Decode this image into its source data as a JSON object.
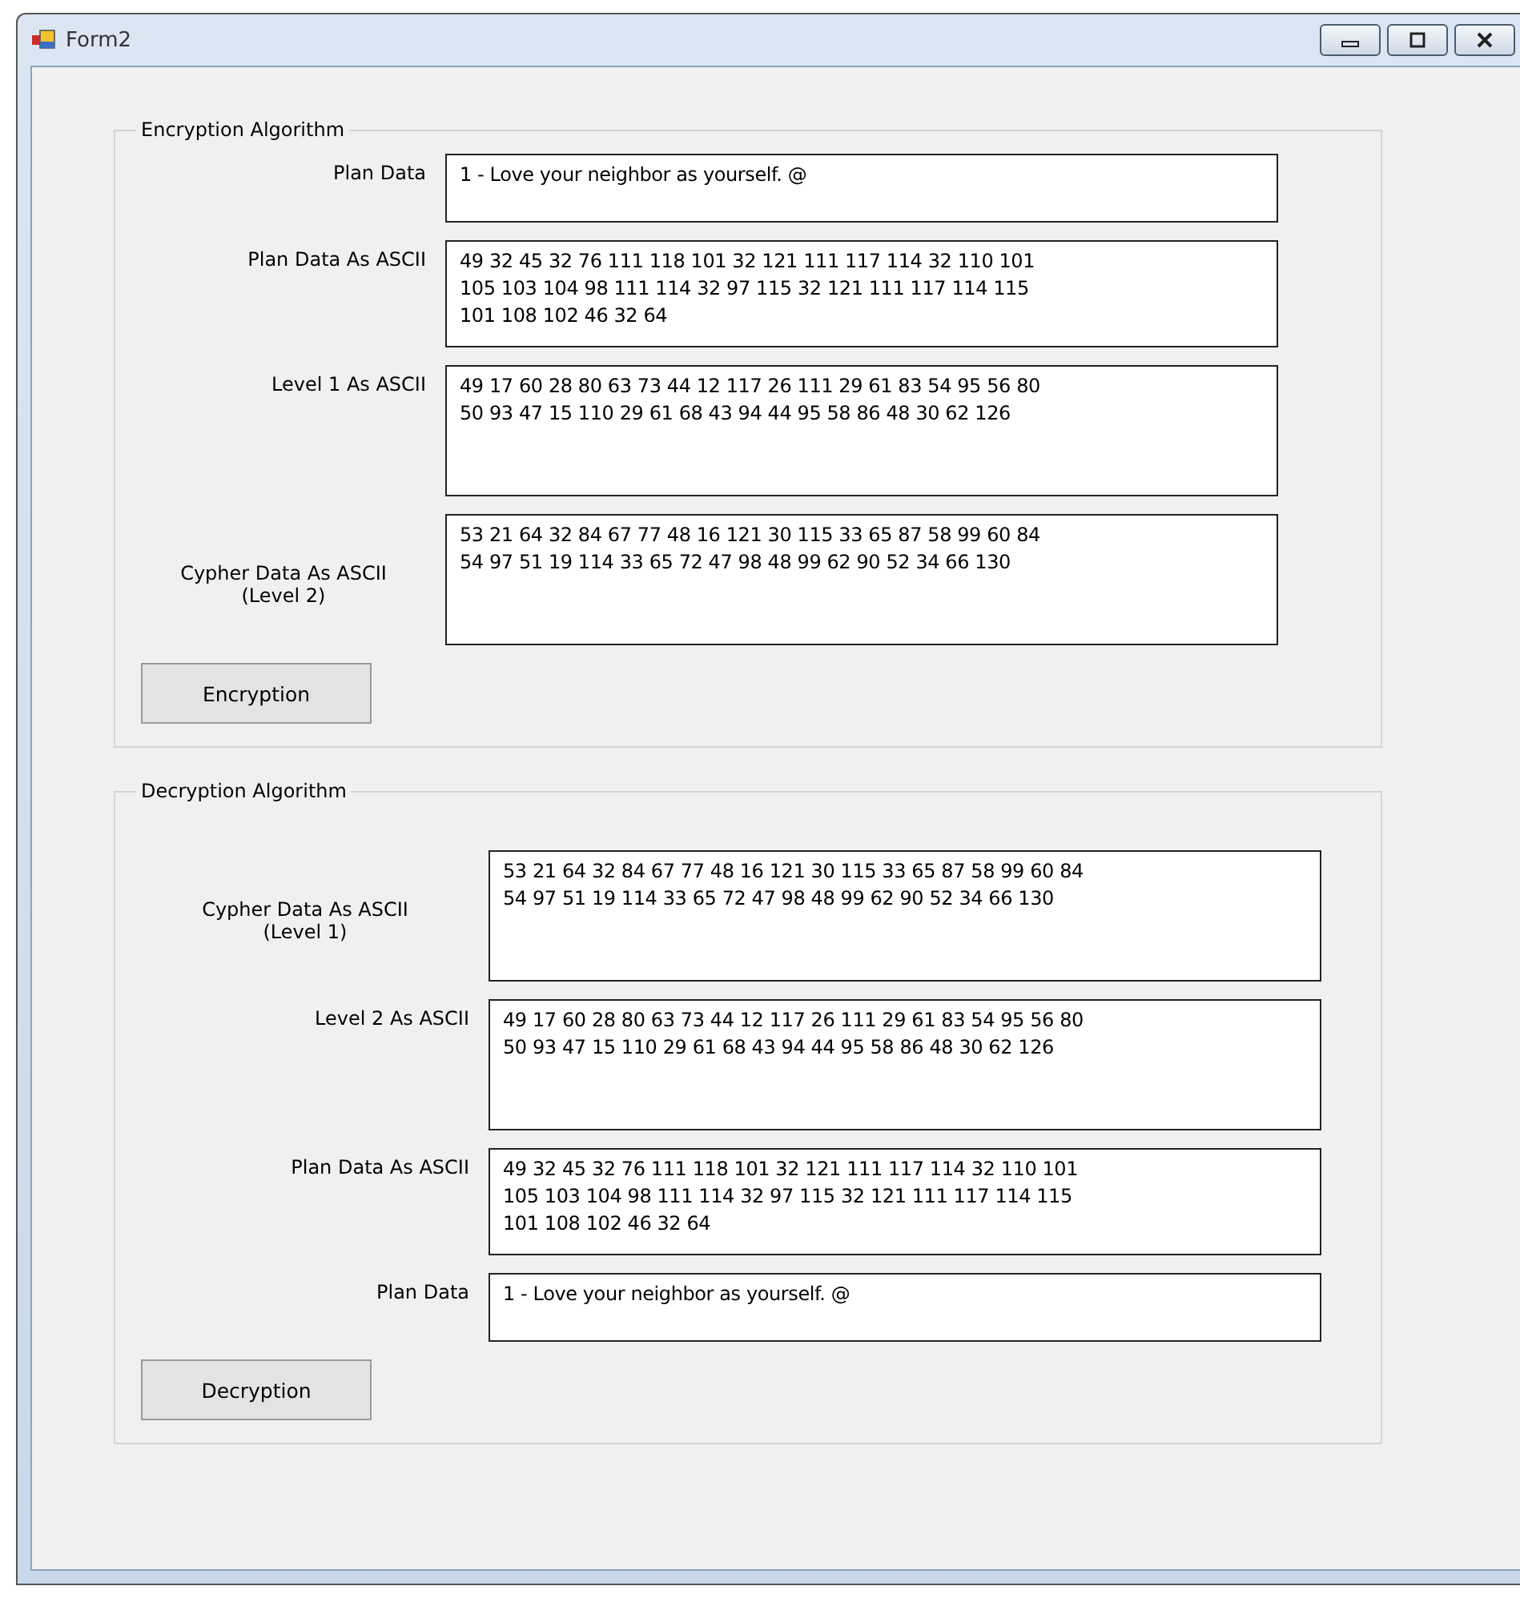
{
  "window": {
    "title": "Form2"
  },
  "groups": [
    {
      "title": "Encryption Algorithm",
      "fields": [
        {
          "label": "Plan Data",
          "kind": "line",
          "value": "1 - Love your neighbor as yourself. @"
        },
        {
          "label": "Plan Data As ASCII",
          "kind": "ascii",
          "value": "49 32 45 32 76 111 118 101 32 121 111 117 114 32 110 101\n105 103 104 98 111 114 32 97 115 32 121 111 117 114 115\n101 108 102 46 32 64"
        },
        {
          "label": "Level 1 As ASCII",
          "kind": "block",
          "value": "49 17 60 28 80 63 73 44 12 117 26 111 29 61 83 54 95 56 80\n50 93 47 15 110 29 61 68 43 94 44 95 58 86 48 30 62 126"
        },
        {
          "label": "Cypher Data As ASCII\n(Level 2)",
          "kind": "block",
          "value": "53 21 64 32 84 67 77 48 16 121 30 115 33 65 87 58 99 60 84\n54 97 51 19 114 33 65 72 47 98 48 99 62 90 52 34 66 130"
        }
      ],
      "button": "Encryption"
    },
    {
      "title": "Decryption Algorithm",
      "fields": [
        {
          "label": "Cypher Data As ASCII\n(Level 1)",
          "kind": "block",
          "value": "53 21 64 32 84 67 77 48 16 121 30 115 33 65 87 58 99 60 84\n54 97 51 19 114 33 65 72 47 98 48 99 62 90 52 34 66 130"
        },
        {
          "label": "Level 2 As ASCII",
          "kind": "block",
          "value": "49 17 60 28 80 63 73 44 12 117 26 111 29 61 83 54 95 56 80\n50 93 47 15 110 29 61 68 43 94 44 95 58 86 48 30 62 126"
        },
        {
          "label": "Plan Data As ASCII",
          "kind": "ascii",
          "value": "49 32 45 32 76 111 118 101 32 121 111 117 114 32 110 101\n105 103 104 98 111 114 32 97 115 32 121 111 117 114 115\n101 108 102 46 32 64"
        },
        {
          "label": "Plan Data",
          "kind": "line",
          "value": "1 - Love your neighbor as yourself. @"
        }
      ],
      "button": "Decryption"
    }
  ]
}
